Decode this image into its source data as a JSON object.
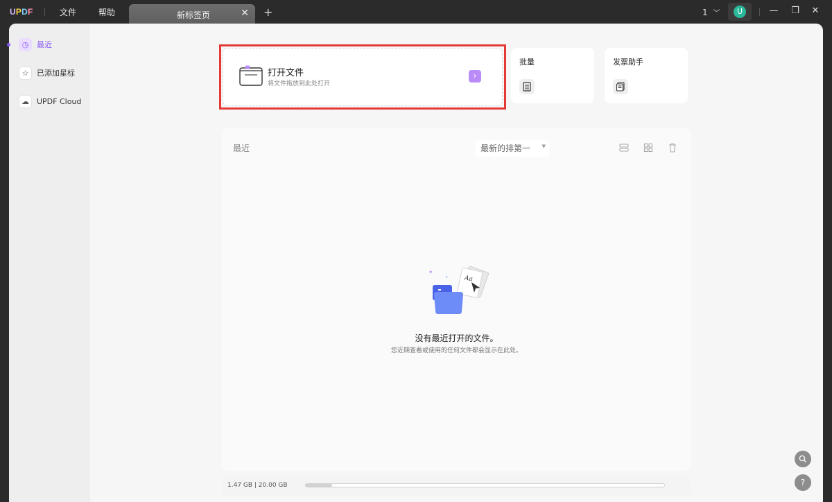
{
  "titlebar": {
    "logo": "UPDF",
    "menu": [
      "文件",
      "帮助"
    ],
    "tab_label": "新标签页",
    "tab_close_icon": "close-icon",
    "new_tab_icon": "plus-icon",
    "page_indicator": "1",
    "avatar_letter": "U",
    "window_controls": [
      "minimize-icon",
      "restore-icon",
      "close-icon"
    ]
  },
  "sidebar": {
    "items": [
      {
        "label": "最近",
        "icon": "clock-icon",
        "active": true
      },
      {
        "label": "已添加星标",
        "icon": "star-icon",
        "active": false
      },
      {
        "label": "UPDF Cloud",
        "icon": "cloud-icon",
        "active": false
      }
    ]
  },
  "open_file": {
    "title": "打开文件",
    "subtitle": "将文件拖放到此处打开"
  },
  "quick_cards": [
    {
      "title": "批量",
      "icon": "batch-icon"
    },
    {
      "title": "发票助手",
      "icon": "invoice-icon"
    }
  ],
  "recent": {
    "title": "最近",
    "sort_label": "最新的排第一",
    "empty_title": "没有最近打开的文件。",
    "empty_subtitle": "您近期查看或使用的任何文件都会显示在此处。"
  },
  "storage": {
    "text": "1.47 GB | 20.00 GB",
    "used_fraction": 0.0735
  },
  "colors": {
    "accent": "#8a5cf5",
    "highlight": "#e53935",
    "avatar": "#29b99a"
  }
}
